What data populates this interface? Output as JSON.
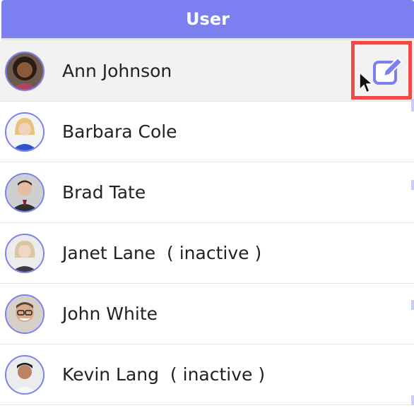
{
  "header": {
    "title": "User"
  },
  "users": [
    {
      "name": "Ann Johnson",
      "selected": true
    },
    {
      "name": "Barbara Cole",
      "selected": false
    },
    {
      "name": "Brad Tate",
      "selected": false
    },
    {
      "name": "Janet Lane  ( inactive )",
      "selected": false
    },
    {
      "name": "John White",
      "selected": false
    },
    {
      "name": "Kevin Lang  ( inactive )",
      "selected": false
    }
  ],
  "icons": {
    "edit": "edit-pencil-icon",
    "cursor": "mouse-pointer"
  },
  "colors": {
    "accent": "#7b7ff0",
    "highlight_border": "#ef4b4b",
    "selected_row": "#f2f2f2",
    "text": "#222222"
  }
}
